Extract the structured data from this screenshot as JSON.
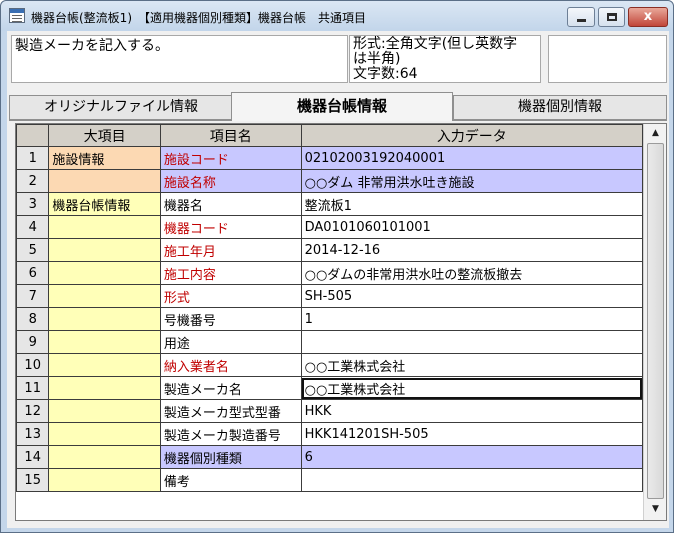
{
  "window": {
    "title": "機器台帳(整流板1)　【適用機器個別種類】機器台帳　共通項目",
    "controls": {
      "minimize": "minimize",
      "maximize": "maximize",
      "close": "x"
    }
  },
  "help": {
    "description": "製造メーカを記入する。",
    "format_lines": [
      "形式:全角文字(但し英数字",
      "は半角)",
      "文字数:64"
    ],
    "extra": ""
  },
  "tabs": [
    {
      "label": "オリジナルファイル情報",
      "active": false
    },
    {
      "label": "機器台帳情報",
      "active": true
    },
    {
      "label": "機器個別情報",
      "active": false
    }
  ],
  "grid": {
    "headers": {
      "row_no": "",
      "category": "大項目",
      "item": "項目名",
      "value": "入力データ"
    },
    "rows": [
      {
        "no": "1",
        "category": "施設情報",
        "item": "施設コード",
        "value": "02102003192040001"
      },
      {
        "no": "2",
        "category": "",
        "item": "施設名称",
        "value": "○○ダム 非常用洪水吐き施設"
      },
      {
        "no": "3",
        "category": "機器台帳情報",
        "item": "機器名",
        "value": "整流板1"
      },
      {
        "no": "4",
        "category": "",
        "item": "機器コード",
        "value": "DA0101060101001"
      },
      {
        "no": "5",
        "category": "",
        "item": "施工年月",
        "value": "2014-12-16"
      },
      {
        "no": "6",
        "category": "",
        "item": "施工内容",
        "value": "○○ダムの非常用洪水吐の整流板撤去"
      },
      {
        "no": "7",
        "category": "",
        "item": "形式",
        "value": "SH-505"
      },
      {
        "no": "8",
        "category": "",
        "item": "号機番号",
        "value": "1"
      },
      {
        "no": "9",
        "category": "",
        "item": "用途",
        "value": ""
      },
      {
        "no": "10",
        "category": "",
        "item": "納入業者名",
        "value": "○○工業株式会社"
      },
      {
        "no": "11",
        "category": "",
        "item": "製造メーカ名",
        "value": "○○工業株式会社"
      },
      {
        "no": "12",
        "category": "",
        "item": "製造メーカ型式型番",
        "value": "HKK"
      },
      {
        "no": "13",
        "category": "",
        "item": "製造メーカ製造番号",
        "value": "HKK141201SH-505"
      },
      {
        "no": "14",
        "category": "",
        "item": "機器個別種類",
        "value": "6"
      },
      {
        "no": "15",
        "category": "",
        "item": "備考",
        "value": ""
      }
    ]
  },
  "scrollbar": {
    "up_icon": "triangle-up",
    "down_icon": "triangle-down"
  },
  "colors": {
    "header_bg": "#d4d0c8",
    "category_yellow": "#ffffb8",
    "category_orange": "#fcd9b3",
    "fixed_row_blue": "#c8c8ff",
    "required_label_red": "#c00000"
  }
}
